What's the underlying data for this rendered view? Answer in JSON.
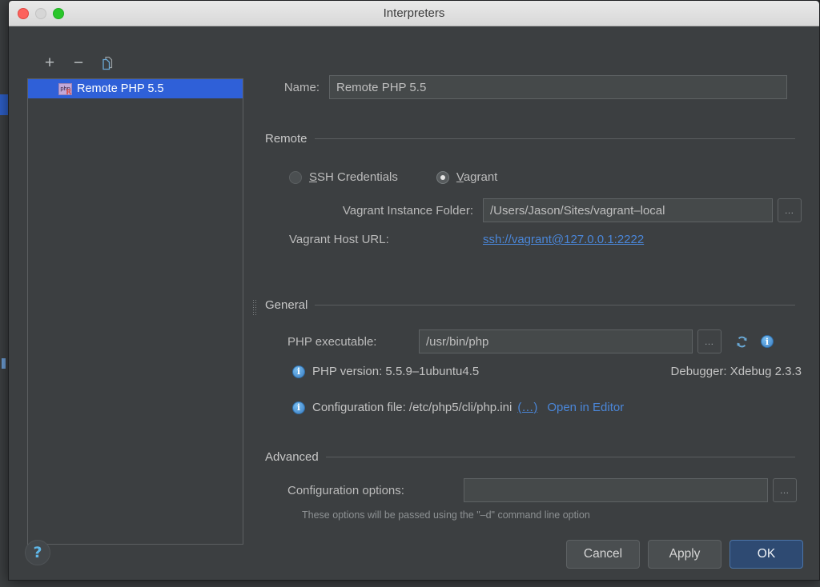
{
  "window": {
    "title": "Interpreters",
    "traffic_lights": [
      "close-red",
      "minimize-yellow-disabled",
      "zoom-green"
    ]
  },
  "sidebar": {
    "toolbar": [
      {
        "icon": "plus-icon",
        "label": "+"
      },
      {
        "icon": "minus-icon",
        "label": "−"
      },
      {
        "icon": "copy-icon",
        "label": ""
      }
    ],
    "items": [
      {
        "label": "Remote PHP 5.5",
        "icon": "php-remote-icon",
        "selected": true
      }
    ]
  },
  "main": {
    "name_field": {
      "label": "Name:",
      "value": "Remote PHP 5.5",
      "placeholder": ""
    },
    "remote": {
      "title": "Remote",
      "radios": [
        {
          "label": "SSH Credentials",
          "mnemonic": "S",
          "selected": false
        },
        {
          "label": "Vagrant",
          "mnemonic": "V",
          "selected": true
        }
      ],
      "instance_folder": {
        "label": "Vagrant Instance Folder:",
        "value": "/Users/Jason/Sites/vagrant–local",
        "browse": "…"
      },
      "host_url": {
        "label": "Vagrant Host URL:",
        "value": "ssh://vagrant@127.0.0.1:2222"
      }
    },
    "general": {
      "title": "General",
      "executable": {
        "label": "PHP executable:",
        "value": "/usr/bin/php",
        "browse": "…",
        "refresh_icon": "refresh-icon",
        "info_icon": "info-icon"
      },
      "version_line": {
        "icon": "info-icon",
        "text": "PHP version: 5.5.9–1ubuntu4.5"
      },
      "debugger_line": {
        "text": "Debugger: Xdebug 2.3.3"
      },
      "config_line": {
        "icon": "info-icon",
        "text": "Configuration file: /etc/php5/cli/php.ini",
        "ellipsis_link": "(…)",
        "open_link": "Open in Editor"
      }
    },
    "advanced": {
      "title": "Advanced",
      "config_options": {
        "label": "Configuration options:",
        "value": "",
        "placeholder": "",
        "browse": "…"
      },
      "hint": "These options will be passed using the \"–d\" command line option"
    }
  },
  "footer": {
    "help_label": "?",
    "buttons": [
      {
        "label": "Cancel",
        "primary": false
      },
      {
        "label": "Apply",
        "primary": false
      },
      {
        "label": "OK",
        "primary": true
      }
    ]
  },
  "colors": {
    "dialog_bg": "#3c3f41",
    "field_bg": "#45494a",
    "selection_blue": "#2f60d8",
    "link_blue": "#4a86d8",
    "primary_button": "#2e4a72",
    "text": "#bbbbbb"
  }
}
